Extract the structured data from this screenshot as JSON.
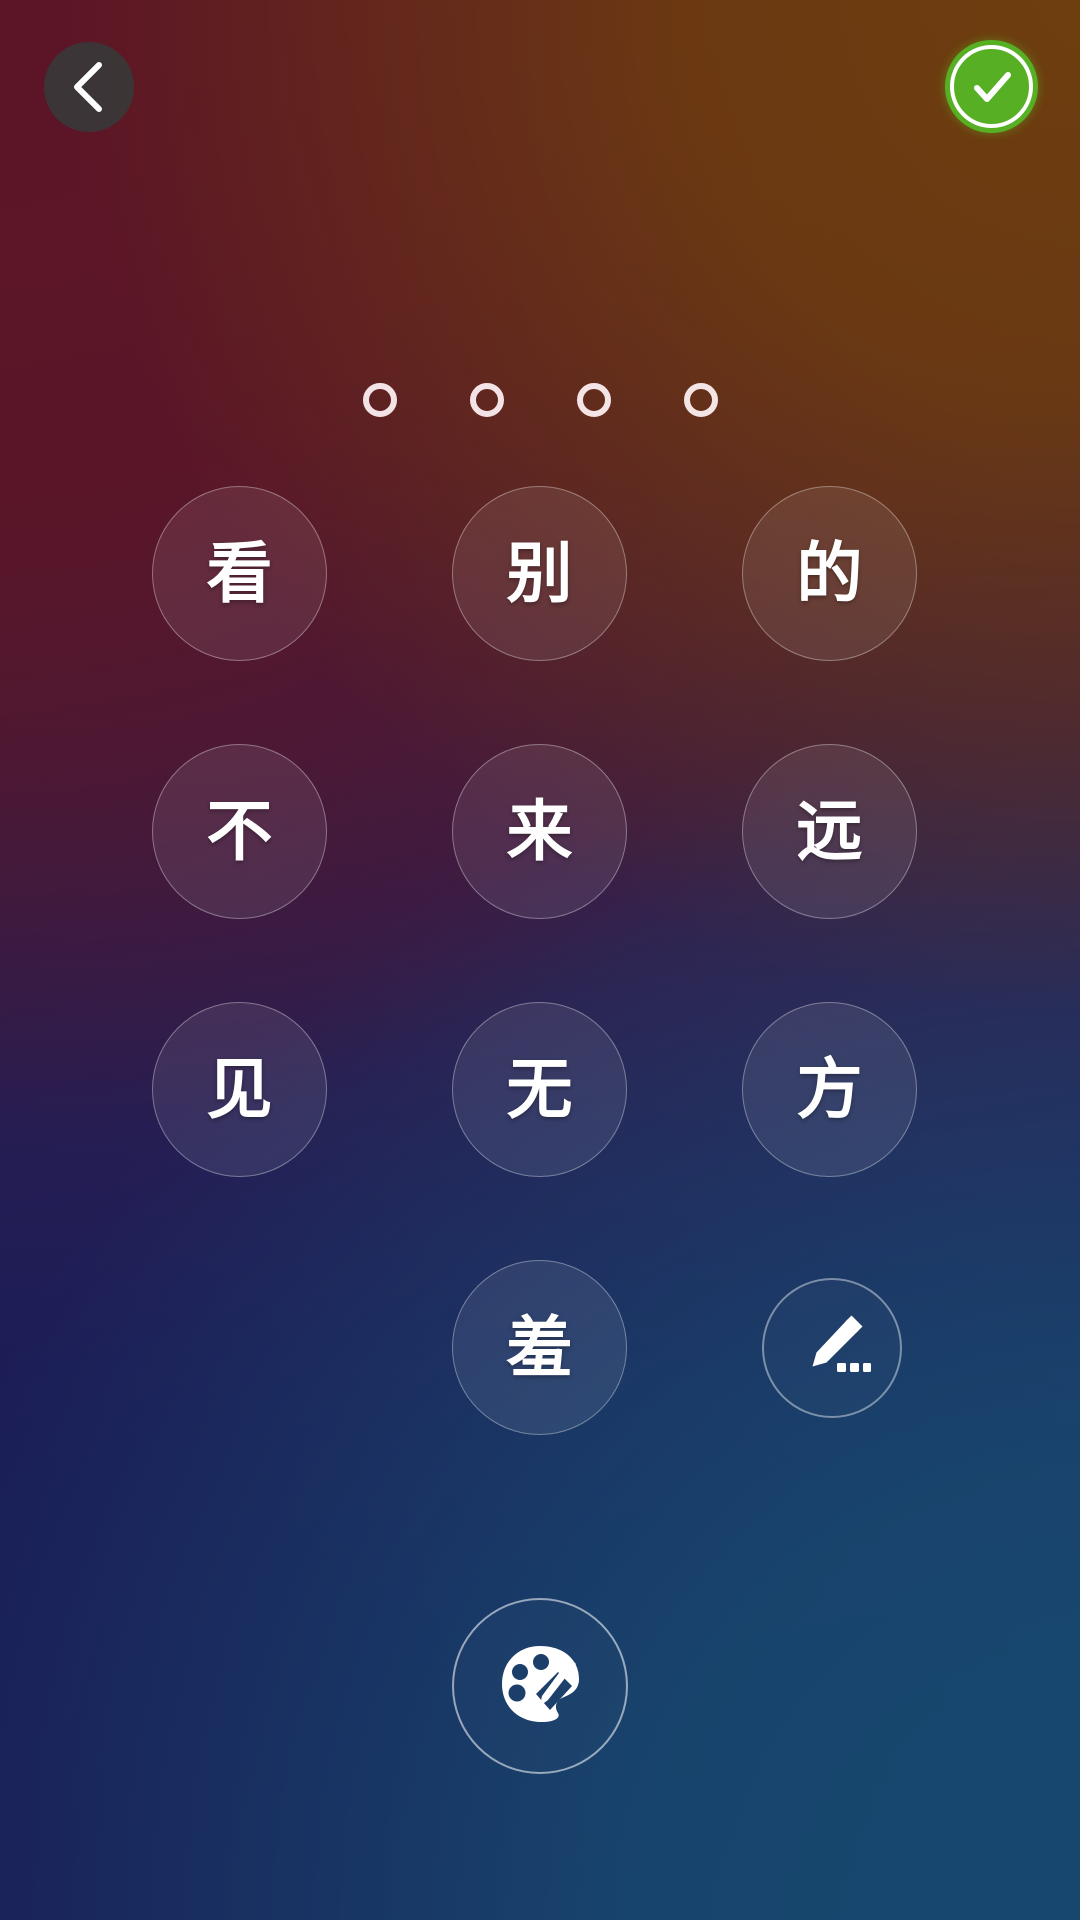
{
  "app": {
    "screen_name": "chinese-character-stroke-practice",
    "background": {
      "top_left_color": "#5c1526",
      "top_right_color": "#5e3410",
      "bottom_left_color": "#1a1c56",
      "bottom_right_color": "#17476e"
    }
  },
  "top_bar": {
    "back_button": {
      "icon": "chevron-left-icon",
      "label": "Back",
      "background_color": "#383838"
    },
    "confirm_button": {
      "icon": "check-icon",
      "label": "Confirm",
      "background_color": "#57b023",
      "ring_color": "#ffffff"
    }
  },
  "indicators": {
    "count": 4,
    "items": [
      {
        "id": "dot-1",
        "filled": false
      },
      {
        "id": "dot-2",
        "filled": false
      },
      {
        "id": "dot-3",
        "filled": false
      },
      {
        "id": "dot-4",
        "filled": false
      }
    ],
    "color": "#fff2f5"
  },
  "character_grid": {
    "rows": [
      {
        "cells": [
          {
            "type": "character",
            "char": "看"
          },
          {
            "type": "character",
            "char": "别"
          },
          {
            "type": "character",
            "char": "的"
          }
        ]
      },
      {
        "cells": [
          {
            "type": "character",
            "char": "不"
          },
          {
            "type": "character",
            "char": "来"
          },
          {
            "type": "character",
            "char": "远"
          }
        ]
      },
      {
        "cells": [
          {
            "type": "character",
            "char": "见"
          },
          {
            "type": "character",
            "char": "无"
          },
          {
            "type": "character",
            "char": "方"
          }
        ]
      },
      {
        "cells": [
          {
            "type": "empty"
          },
          {
            "type": "character",
            "char": "羞"
          },
          {
            "type": "icon",
            "icon": "pencil-more-icon",
            "label": "More / Edit"
          }
        ]
      }
    ]
  },
  "palette_button": {
    "icon": "palette-brush-icon",
    "label": "Theme / Color"
  }
}
